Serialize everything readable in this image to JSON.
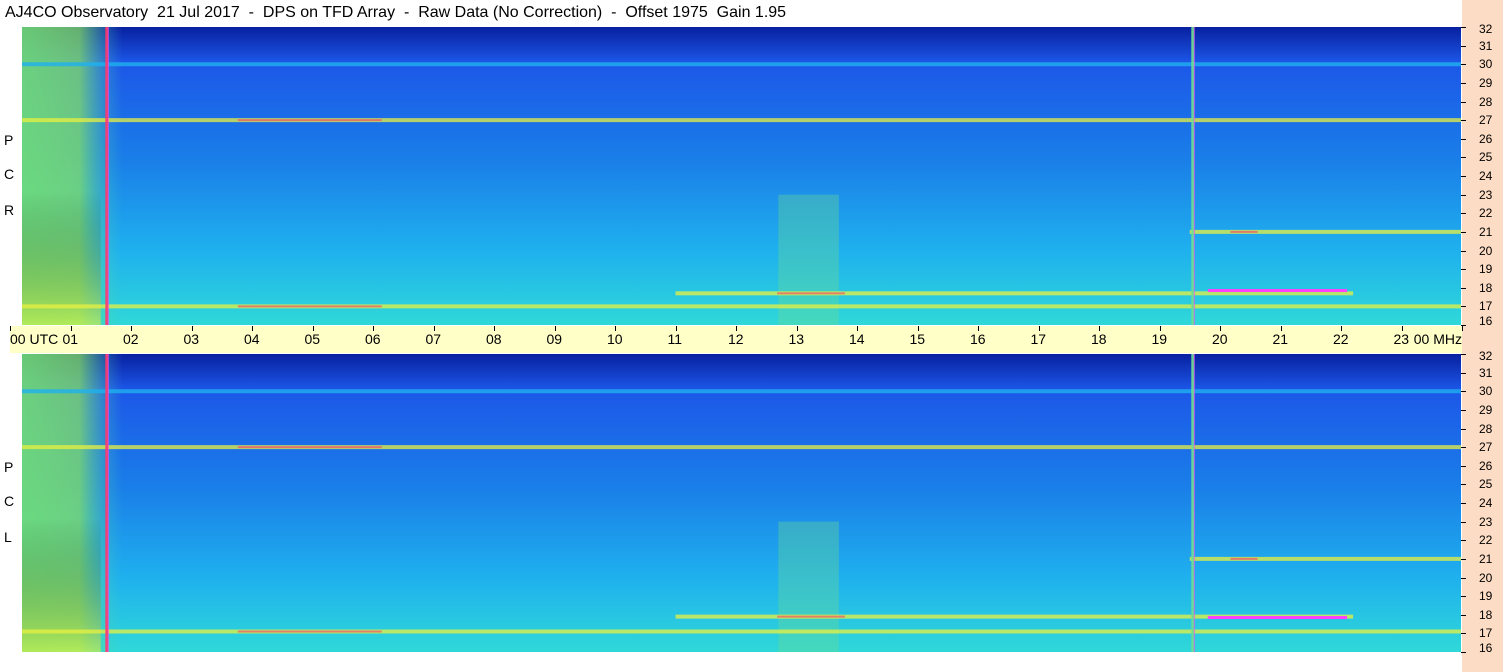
{
  "title": "AJ4CO Observatory  21 Jul 2017  -  DPS on TFD Array  -  Raw Data (No Correction)  -  Offset 1975  Gain 1.95",
  "panels": [
    {
      "id": "rcp",
      "label_letters": [
        "R",
        "C",
        "P"
      ]
    },
    {
      "id": "lcp",
      "label_letters": [
        "L",
        "C",
        "P"
      ]
    }
  ],
  "time_axis": {
    "labels": [
      "00 UTC",
      "01",
      "02",
      "03",
      "04",
      "05",
      "06",
      "07",
      "08",
      "09",
      "10",
      "11",
      "12",
      "13",
      "14",
      "15",
      "16",
      "17",
      "18",
      "19",
      "20",
      "21",
      "22",
      "23",
      "00 MHz"
    ]
  },
  "freq_axis": {
    "labels": [
      "32",
      "31",
      "30",
      "29",
      "28",
      "27",
      "26",
      "25",
      "24",
      "23",
      "22",
      "21",
      "20",
      "19",
      "18",
      "17",
      "16"
    ],
    "unit": "MHz"
  },
  "colors": {
    "deep_blue": "#0820a0",
    "blue": "#1c57e8",
    "cyan": "#1fb0ee",
    "aqua": "#2fd8d8",
    "green": "#6ee090",
    "yellow": "#e8f040",
    "red": "#ff3a6a",
    "magenta": "#ff40ff"
  },
  "chart_data": {
    "type": "heatmap",
    "title": "AJ4CO Observatory  21 Jul 2017  -  DPS on TFD Array  -  Raw Data (No Correction)  -  Offset 1975  Gain 1.95",
    "xlabel": "UTC",
    "ylabel": "MHz",
    "x_range_hours": [
      0,
      24
    ],
    "y_range_mhz": [
      16,
      32
    ],
    "series": [
      {
        "name": "RCP",
        "persistent_bands_mhz": [
          {
            "freq": 27.0,
            "start_h": 0.0,
            "end_h": 24.0,
            "level": "yellow"
          },
          {
            "freq": 30.0,
            "start_h": 0.0,
            "end_h": 24.0,
            "level": "cyan"
          },
          {
            "freq": 17.0,
            "start_h": 0.0,
            "end_h": 24.0,
            "level": "yellow"
          },
          {
            "freq": 17.7,
            "start_h": 11.0,
            "end_h": 22.2,
            "level": "yellow"
          },
          {
            "freq": 21.0,
            "start_h": 19.5,
            "end_h": 24.0,
            "level": "yellow"
          }
        ],
        "vertical_lines_h": [
          1.6,
          19.55
        ]
      },
      {
        "name": "LCP",
        "persistent_bands_mhz": [
          {
            "freq": 27.0,
            "start_h": 0.0,
            "end_h": 24.0,
            "level": "yellow"
          },
          {
            "freq": 30.0,
            "start_h": 0.0,
            "end_h": 24.0,
            "level": "cyan"
          },
          {
            "freq": 17.1,
            "start_h": 0.0,
            "end_h": 24.0,
            "level": "yellow"
          },
          {
            "freq": 17.9,
            "start_h": 11.0,
            "end_h": 22.2,
            "level": "yellow"
          },
          {
            "freq": 21.0,
            "start_h": 19.5,
            "end_h": 24.0,
            "level": "yellow"
          }
        ],
        "vertical_lines_h": [
          1.6,
          19.55
        ]
      }
    ]
  }
}
